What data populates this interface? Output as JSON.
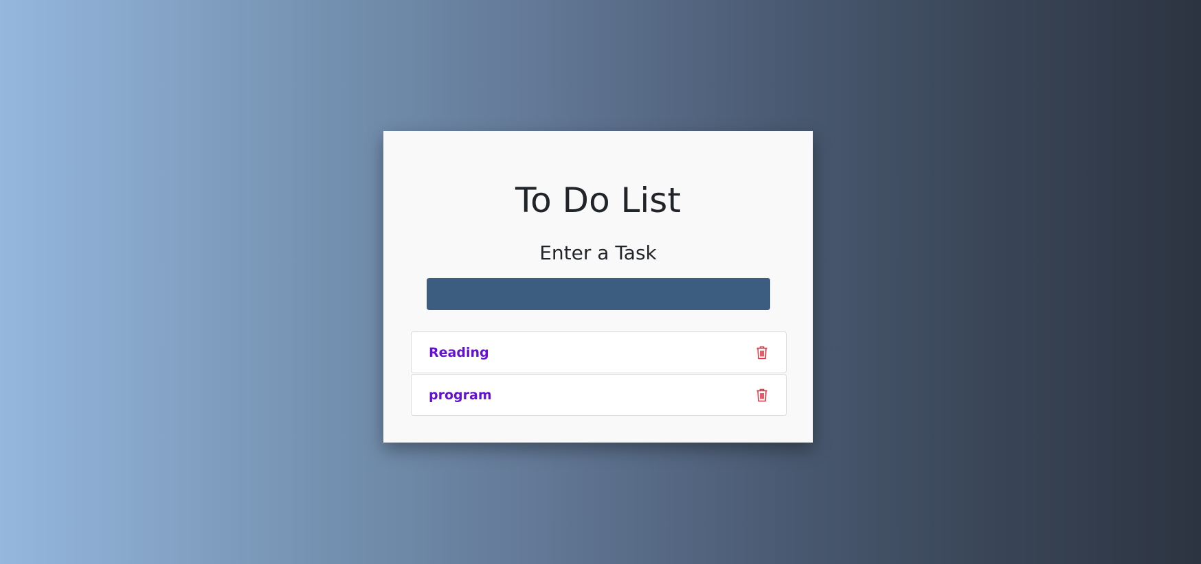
{
  "app": {
    "title": "To Do List",
    "subtitle": "Enter a Task"
  },
  "input": {
    "value": "",
    "placeholder": ""
  },
  "tasks": [
    {
      "label": "Reading",
      "icon": "trash-icon"
    },
    {
      "label": "program",
      "icon": "trash-icon"
    }
  ],
  "colors": {
    "accent": "#6610d6",
    "delete": "#dc3545",
    "input_bg": "#3c5d80"
  }
}
